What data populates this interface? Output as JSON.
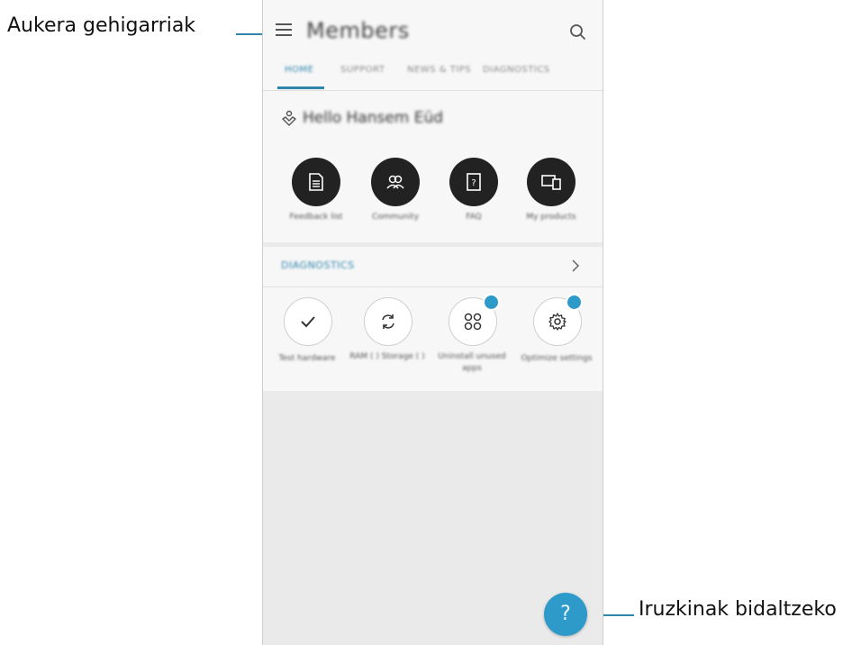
{
  "callouts": {
    "menu": "Aukera gehigarriak",
    "feedback": "Iruzkinak bidaltzeko"
  },
  "app": {
    "title": "Members",
    "tabs": [
      "HOME",
      "SUPPORT",
      "NEWS & TIPS",
      "DIAGNOSTICS"
    ],
    "active_tab": "HOME",
    "greeting": "Hello Hansem Eüd",
    "quick_actions": [
      {
        "label": "Feedback list",
        "icon": "document-icon"
      },
      {
        "label": "Community",
        "icon": "people-icon"
      },
      {
        "label": "FAQ",
        "icon": "help-book-icon"
      },
      {
        "label": "My products",
        "icon": "devices-icon"
      }
    ],
    "diagnostics": {
      "title": "DIAGNOSTICS",
      "items": [
        {
          "label": "Test hardware",
          "icon": "check-icon",
          "badge": false
        },
        {
          "label": "RAM ( ) Storage ( )",
          "icon": "refresh-icon",
          "badge": true
        },
        {
          "label": "Uninstall unused apps",
          "icon": "apps-icon",
          "badge": true
        },
        {
          "label": "Optimize settings",
          "icon": "gear-icon",
          "badge": true
        }
      ]
    },
    "fab_label": "?"
  },
  "colors": {
    "accent": "#2e86ab",
    "fab": "#2e9ac9",
    "dark_button": "#222222"
  }
}
